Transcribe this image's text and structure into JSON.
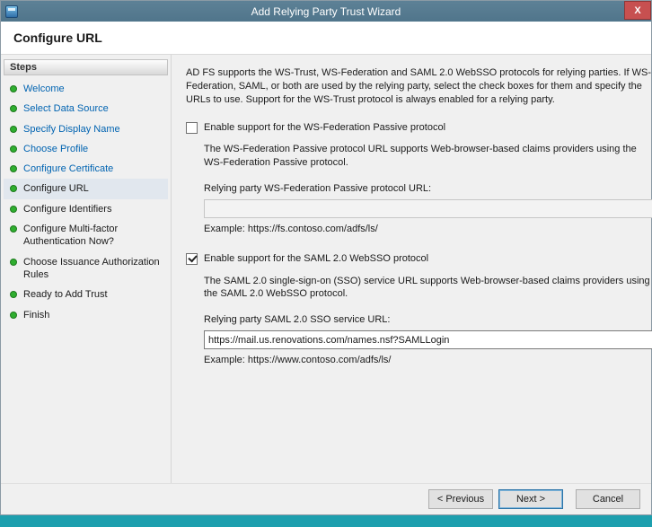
{
  "window": {
    "title": "Add Relying Party Trust Wizard",
    "close_label": "X"
  },
  "page": {
    "heading": "Configure URL"
  },
  "sidebar": {
    "header": "Steps",
    "items": [
      {
        "label": "Welcome",
        "state": "done"
      },
      {
        "label": "Select Data Source",
        "state": "done"
      },
      {
        "label": "Specify Display Name",
        "state": "done"
      },
      {
        "label": "Choose Profile",
        "state": "done"
      },
      {
        "label": "Configure Certificate",
        "state": "done"
      },
      {
        "label": "Configure URL",
        "state": "current"
      },
      {
        "label": "Configure Identifiers",
        "state": "todo"
      },
      {
        "label": "Configure Multi-factor Authentication Now?",
        "state": "todo"
      },
      {
        "label": "Choose Issuance Authorization Rules",
        "state": "todo"
      },
      {
        "label": "Ready to Add Trust",
        "state": "todo"
      },
      {
        "label": "Finish",
        "state": "todo"
      }
    ]
  },
  "content": {
    "intro": "AD FS supports the WS-Trust, WS-Federation and SAML 2.0 WebSSO protocols for relying parties.  If WS-Federation, SAML, or both are used by the relying party, select the check boxes for them and specify the URLs to use.  Support for the WS-Trust protocol is always enabled for a relying party.",
    "wsfed": {
      "checkbox_label": "Enable support for the WS-Federation Passive protocol",
      "checked": false,
      "description": "The WS-Federation Passive protocol URL supports Web-browser-based claims providers using the WS-Federation Passive protocol.",
      "url_label": "Relying party WS-Federation Passive protocol URL:",
      "url_value": "",
      "example": "Example: https://fs.contoso.com/adfs/ls/"
    },
    "saml": {
      "checkbox_label": "Enable support for the SAML 2.0 WebSSO protocol",
      "checked": true,
      "description": "The SAML 2.0 single-sign-on (SSO) service URL supports Web-browser-based claims providers using the SAML 2.0 WebSSO protocol.",
      "url_label": "Relying party SAML 2.0 SSO service URL:",
      "url_value": "https://mail.us.renovations.com/names.nsf?SAMLLogin",
      "example": "Example: https://www.contoso.com/adfs/ls/"
    }
  },
  "footer": {
    "previous_label": "< Previous",
    "next_label": "Next >",
    "cancel_label": "Cancel"
  }
}
